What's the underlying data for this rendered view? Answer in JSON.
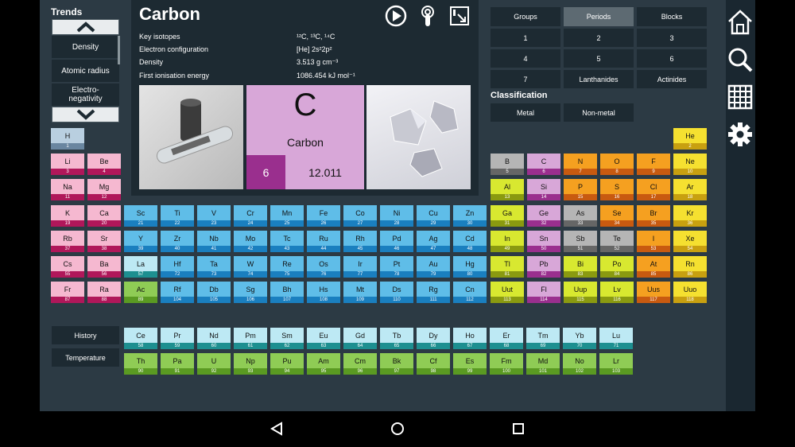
{
  "trends": {
    "title": "Trends",
    "items": [
      "Density",
      "Atomic radius",
      "Electro-\nnegativity"
    ]
  },
  "element": {
    "name": "Carbon",
    "symbol": "C",
    "number": "6",
    "mass": "12.011",
    "properties": [
      {
        "key": "Key isotopes",
        "value": "¹²C, ¹³C, ¹⁴C"
      },
      {
        "key": "Electron configuration",
        "value": "[He] 2s²2p²"
      },
      {
        "key": "Density",
        "value": "3.513 g cm⁻³"
      },
      {
        "key": "First ionisation energy",
        "value": "1086.454 kJ mol⁻¹"
      }
    ]
  },
  "groups_row": [
    "Groups",
    "Periods",
    "Blocks"
  ],
  "selected_view": "Periods",
  "periods": [
    "1",
    "2",
    "3",
    "4",
    "5",
    "6",
    "7",
    "Lanthanides",
    "Actinides"
  ],
  "classification": {
    "title": "Classification",
    "items": [
      "Metal",
      "Non-metal"
    ]
  },
  "side_buttons": [
    "History",
    "Temperature"
  ],
  "colors": {
    "alkali": "#f5b8d0",
    "alkaline": "#f5b8d0",
    "transition": "#5fbde8",
    "lanthanide": "#bde9f4",
    "actinide": "#8fcc55",
    "post_transition": "#d8e830",
    "metalloid": "#b5b5b5",
    "nonmetal": "#f5a020",
    "halogen": "#f5a020",
    "noble": "#f5e030"
  },
  "elements": [
    {
      "s": "H",
      "n": 1
    },
    {
      "s": "He",
      "n": 2
    },
    {
      "s": "Li",
      "n": 3
    },
    {
      "s": "Be",
      "n": 4
    },
    {
      "s": "B",
      "n": 5
    },
    {
      "s": "C",
      "n": 6
    },
    {
      "s": "N",
      "n": 7
    },
    {
      "s": "O",
      "n": 8
    },
    {
      "s": "F",
      "n": 9
    },
    {
      "s": "Ne",
      "n": 10
    },
    {
      "s": "Na",
      "n": 11
    },
    {
      "s": "Mg",
      "n": 12
    },
    {
      "s": "Al",
      "n": 13
    },
    {
      "s": "Si",
      "n": 14
    },
    {
      "s": "P",
      "n": 15
    },
    {
      "s": "S",
      "n": 16
    },
    {
      "s": "Cl",
      "n": 17
    },
    {
      "s": "Ar",
      "n": 18
    },
    {
      "s": "K",
      "n": 19
    },
    {
      "s": "Ca",
      "n": 20
    },
    {
      "s": "Sc",
      "n": 21
    },
    {
      "s": "Ti",
      "n": 22
    },
    {
      "s": "V",
      "n": 23
    },
    {
      "s": "Cr",
      "n": 24
    },
    {
      "s": "Mn",
      "n": 25
    },
    {
      "s": "Fe",
      "n": 26
    },
    {
      "s": "Co",
      "n": 27
    },
    {
      "s": "Ni",
      "n": 28
    },
    {
      "s": "Cu",
      "n": 29
    },
    {
      "s": "Zn",
      "n": 30
    },
    {
      "s": "Ga",
      "n": 31
    },
    {
      "s": "Ge",
      "n": 32
    },
    {
      "s": "As",
      "n": 33
    },
    {
      "s": "Se",
      "n": 34
    },
    {
      "s": "Br",
      "n": 35
    },
    {
      "s": "Kr",
      "n": 36
    },
    {
      "s": "Rb",
      "n": 37
    },
    {
      "s": "Sr",
      "n": 38
    },
    {
      "s": "Y",
      "n": 39
    },
    {
      "s": "Zr",
      "n": 40
    },
    {
      "s": "Nb",
      "n": 41
    },
    {
      "s": "Mo",
      "n": 42
    },
    {
      "s": "Tc",
      "n": 43
    },
    {
      "s": "Ru",
      "n": 44
    },
    {
      "s": "Rh",
      "n": 45
    },
    {
      "s": "Pd",
      "n": 46
    },
    {
      "s": "Ag",
      "n": 47
    },
    {
      "s": "Cd",
      "n": 48
    },
    {
      "s": "In",
      "n": 49
    },
    {
      "s": "Sn",
      "n": 50
    },
    {
      "s": "Sb",
      "n": 51
    },
    {
      "s": "Te",
      "n": 52
    },
    {
      "s": "I",
      "n": 53
    },
    {
      "s": "Xe",
      "n": 54
    },
    {
      "s": "Cs",
      "n": 55
    },
    {
      "s": "Ba",
      "n": 56
    },
    {
      "s": "La",
      "n": 57
    },
    {
      "s": "Hf",
      "n": 72
    },
    {
      "s": "Ta",
      "n": 73
    },
    {
      "s": "W",
      "n": 74
    },
    {
      "s": "Re",
      "n": 75
    },
    {
      "s": "Os",
      "n": 76
    },
    {
      "s": "Ir",
      "n": 77
    },
    {
      "s": "Pt",
      "n": 78
    },
    {
      "s": "Au",
      "n": 79
    },
    {
      "s": "Hg",
      "n": 80
    },
    {
      "s": "Tl",
      "n": 81
    },
    {
      "s": "Pb",
      "n": 82
    },
    {
      "s": "Bi",
      "n": 83
    },
    {
      "s": "Po",
      "n": 84
    },
    {
      "s": "At",
      "n": 85
    },
    {
      "s": "Rn",
      "n": 86
    },
    {
      "s": "Fr",
      "n": 87
    },
    {
      "s": "Ra",
      "n": 88
    },
    {
      "s": "Ac",
      "n": 89
    },
    {
      "s": "Rf",
      "n": 104
    },
    {
      "s": "Db",
      "n": 105
    },
    {
      "s": "Sg",
      "n": 106
    },
    {
      "s": "Bh",
      "n": 107
    },
    {
      "s": "Hs",
      "n": 108
    },
    {
      "s": "Mt",
      "n": 109
    },
    {
      "s": "Ds",
      "n": 110
    },
    {
      "s": "Rg",
      "n": 111
    },
    {
      "s": "Cn",
      "n": 112
    },
    {
      "s": "Uut",
      "n": 113
    },
    {
      "s": "Fl",
      "n": 114
    },
    {
      "s": "Uup",
      "n": 115
    },
    {
      "s": "Lv",
      "n": 116
    },
    {
      "s": "Uus",
      "n": 117
    },
    {
      "s": "Uuo",
      "n": 118
    },
    {
      "s": "Ce",
      "n": 58
    },
    {
      "s": "Pr",
      "n": 59
    },
    {
      "s": "Nd",
      "n": 60
    },
    {
      "s": "Pm",
      "n": 61
    },
    {
      "s": "Sm",
      "n": 62
    },
    {
      "s": "Eu",
      "n": 63
    },
    {
      "s": "Gd",
      "n": 64
    },
    {
      "s": "Tb",
      "n": 65
    },
    {
      "s": "Dy",
      "n": 66
    },
    {
      "s": "Ho",
      "n": 67
    },
    {
      "s": "Er",
      "n": 68
    },
    {
      "s": "Tm",
      "n": 69
    },
    {
      "s": "Yb",
      "n": 70
    },
    {
      "s": "Lu",
      "n": 71
    },
    {
      "s": "Th",
      "n": 90
    },
    {
      "s": "Pa",
      "n": 91
    },
    {
      "s": "U",
      "n": 92
    },
    {
      "s": "Np",
      "n": 93
    },
    {
      "s": "Pu",
      "n": 94
    },
    {
      "s": "Am",
      "n": 95
    },
    {
      "s": "Cm",
      "n": 96
    },
    {
      "s": "Bk",
      "n": 97
    },
    {
      "s": "Cf",
      "n": 98
    },
    {
      "s": "Es",
      "n": 99
    },
    {
      "s": "Fm",
      "n": 100
    },
    {
      "s": "Md",
      "n": 101
    },
    {
      "s": "No",
      "n": 102
    },
    {
      "s": "Lr",
      "n": 103
    }
  ],
  "icons": [
    "play-icon",
    "touch-icon",
    "resize-icon",
    "home-icon",
    "search-icon",
    "grid-icon",
    "gear-icon",
    "back-icon",
    "home-circle-icon",
    "recents-icon"
  ]
}
